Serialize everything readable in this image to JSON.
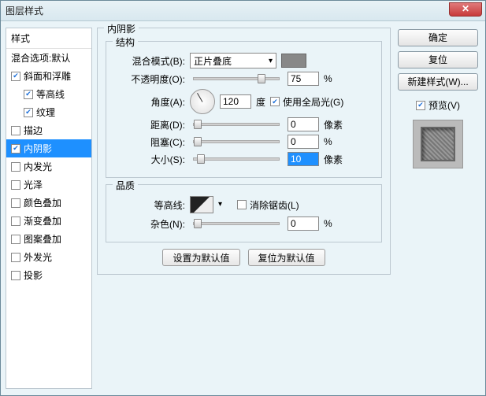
{
  "window": {
    "title": "图层样式"
  },
  "left": {
    "header": "样式",
    "blend_defaults": "混合选项:默认",
    "items": [
      {
        "key": "bevel",
        "label": "斜面和浮雕",
        "checked": true
      },
      {
        "key": "contour",
        "label": "等高线",
        "checked": true,
        "indent": true
      },
      {
        "key": "texture",
        "label": "纹理",
        "checked": true,
        "indent": true
      },
      {
        "key": "stroke",
        "label": "描边",
        "checked": false
      },
      {
        "key": "inner_shadow",
        "label": "内阴影",
        "checked": true,
        "selected": true
      },
      {
        "key": "inner_glow",
        "label": "内发光",
        "checked": false
      },
      {
        "key": "satin",
        "label": "光泽",
        "checked": false
      },
      {
        "key": "color_overlay",
        "label": "颜色叠加",
        "checked": false
      },
      {
        "key": "gradient_overlay",
        "label": "渐变叠加",
        "checked": false
      },
      {
        "key": "pattern_overlay",
        "label": "图案叠加",
        "checked": false
      },
      {
        "key": "outer_glow",
        "label": "外发光",
        "checked": false
      },
      {
        "key": "drop_shadow",
        "label": "投影",
        "checked": false
      }
    ]
  },
  "center": {
    "panel_title": "内阴影",
    "structure_title": "结构",
    "quality_title": "品质",
    "blend_mode_label": "混合模式(B):",
    "blend_mode_value": "正片叠底",
    "opacity_label": "不透明度(O):",
    "opacity_value": "75",
    "percent": "%",
    "angle_label": "角度(A):",
    "angle_value": "120",
    "degree": "度",
    "global_light_label": "使用全局光(G)",
    "global_light_checked": true,
    "distance_label": "距离(D):",
    "distance_value": "0",
    "px": "像素",
    "choke_label": "阻塞(C):",
    "choke_value": "0",
    "size_label": "大小(S):",
    "size_value": "10",
    "contour_label": "等高线:",
    "antialias_label": "消除锯齿(L)",
    "antialias_checked": false,
    "noise_label": "杂色(N):",
    "noise_value": "0",
    "make_default": "设置为默认值",
    "reset_default": "复位为默认值",
    "color_swatch": "#808080"
  },
  "right": {
    "ok": "确定",
    "reset": "复位",
    "new_style": "新建样式(W)...",
    "preview_label": "预览(V)",
    "preview_checked": true
  }
}
